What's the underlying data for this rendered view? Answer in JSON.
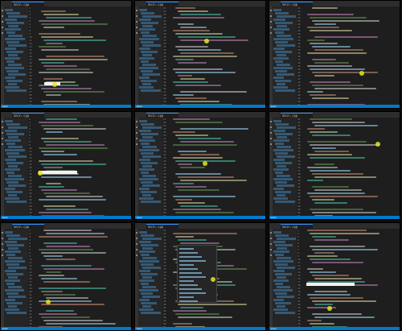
{
  "app": {
    "accent_color": "#007acc",
    "editor_bg": "#1e1e1e",
    "sidebar_bg": "#252526"
  },
  "panels": [
    {
      "id": "p1",
      "tab_label": "main.cpp",
      "status": "main",
      "line_start": 1
    },
    {
      "id": "p2",
      "tab_label": "main.cpp",
      "status": "main",
      "line_start": 21
    },
    {
      "id": "p3",
      "tab_label": "main.cpp",
      "status": "main",
      "line_start": 21
    },
    {
      "id": "p4",
      "tab_label": "main.cpp",
      "status": "main",
      "line_start": 1
    },
    {
      "id": "p5",
      "tab_label": "main.cpp",
      "status": "main",
      "line_start": 21
    },
    {
      "id": "p6",
      "tab_label": "main.cpp",
      "status": "main",
      "line_start": 21
    },
    {
      "id": "p7",
      "tab_label": "main.cpp",
      "status": "main",
      "line_start": 1
    },
    {
      "id": "p8",
      "tab_label": "main.cpp",
      "status": "main",
      "line_start": 21
    },
    {
      "id": "p9",
      "tab_label": "main.cpp",
      "status": "main",
      "line_start": 1
    }
  ],
  "icons": {
    "explorer": "files-icon",
    "search": "search-icon",
    "git": "source-control-icon",
    "debug": "debug-icon",
    "extensions": "extensions-icon",
    "cursor": "cursor-highlight-icon"
  }
}
